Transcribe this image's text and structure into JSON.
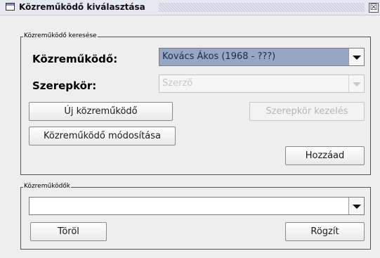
{
  "window": {
    "title": "Közreműködő kiválasztása",
    "close_glyph": "☒"
  },
  "search_group": {
    "legend": "Közreműködő keresése",
    "contributor_label": "Közreműködő:",
    "contributor_value": "Kovács Ákos (1968 - ???)",
    "role_label": "Szerepkör:",
    "role_value": "Szerző",
    "new_contributor_button": "Új közreműködő",
    "role_management_button": "Szerepkör kezelés",
    "modify_contributor_button": "Közreműködő módosítása",
    "add_button": "Hozzáad"
  },
  "contributors_group": {
    "legend": "Közreműködők",
    "list_value": "",
    "delete_button": "Töröl",
    "save_button": "Rögzít"
  },
  "icons": [
    "window-icon",
    "close-icon",
    "dropdown-arrow-icon"
  ]
}
